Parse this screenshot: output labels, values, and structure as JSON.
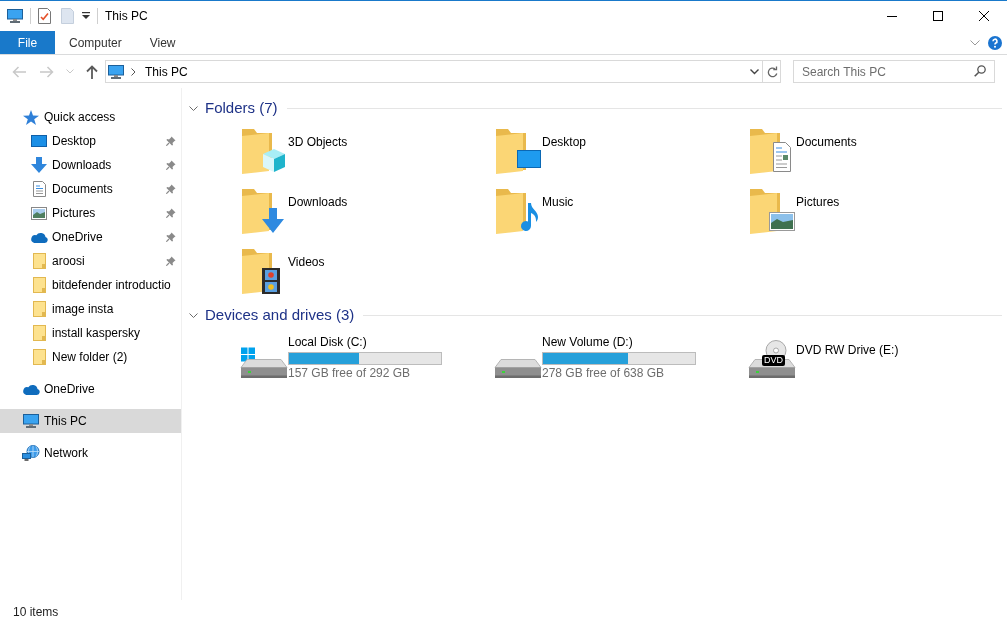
{
  "window": {
    "title": "This PC"
  },
  "ribbon": {
    "tabs": [
      {
        "label": "File",
        "kind": "file"
      },
      {
        "label": "Computer",
        "kind": "tab"
      },
      {
        "label": "View",
        "kind": "tab"
      }
    ]
  },
  "toolbar": {
    "nav_buttons": [
      {
        "kind": "back",
        "disabled": true
      },
      {
        "kind": "forward",
        "disabled": true
      },
      {
        "kind": "recent",
        "disabled": true
      },
      {
        "kind": "up",
        "disabled": false
      }
    ],
    "address": {
      "path": [
        "This PC"
      ]
    },
    "search": {
      "placeholder": "Search This PC"
    }
  },
  "navigation": {
    "items": [
      {
        "label": "Quick access",
        "kind": "quickaccess",
        "selected": false,
        "children": [
          {
            "label": "Desktop",
            "kind": "desktop",
            "pinned": true,
            "selected": false
          },
          {
            "label": "Downloads",
            "kind": "downloads",
            "pinned": true,
            "selected": false
          },
          {
            "label": "Documents",
            "kind": "documents",
            "pinned": true,
            "selected": false
          },
          {
            "label": "Pictures",
            "kind": "pictures",
            "pinned": true,
            "selected": false
          },
          {
            "label": "OneDrive",
            "kind": "onedrive",
            "pinned": true,
            "selected": false
          },
          {
            "label": "aroosi",
            "kind": "folder",
            "pinned": true,
            "selected": false
          },
          {
            "label": "bitdefender introductio",
            "kind": "folder",
            "pinned": false,
            "selected": false
          },
          {
            "label": "image insta",
            "kind": "folder",
            "pinned": false,
            "selected": false
          },
          {
            "label": "install kaspersky",
            "kind": "folder",
            "pinned": false,
            "selected": false
          },
          {
            "label": "New folder (2)",
            "kind": "folder",
            "pinned": false,
            "selected": false
          }
        ]
      },
      {
        "label": "OneDrive",
        "kind": "onedrive",
        "selected": false
      },
      {
        "label": "This PC",
        "kind": "pc",
        "selected": true
      },
      {
        "label": "Network",
        "kind": "network",
        "selected": false
      }
    ]
  },
  "content": {
    "groups": [
      {
        "title": "Folders (7)",
        "kind": "folders",
        "expanded": true,
        "items": [
          {
            "name": "3D Objects",
            "kind": "objects"
          },
          {
            "name": "Desktop",
            "kind": "desktop"
          },
          {
            "name": "Documents",
            "kind": "documents"
          },
          {
            "name": "Downloads",
            "kind": "downloads"
          },
          {
            "name": "Music",
            "kind": "music"
          },
          {
            "name": "Pictures",
            "kind": "pictures"
          },
          {
            "name": "Videos",
            "kind": "videos"
          }
        ]
      },
      {
        "title": "Devices and drives (3)",
        "kind": "drives",
        "expanded": true,
        "items": [
          {
            "name": "Local Disk (C:)",
            "kind": "system",
            "level": 0.46,
            "reading": "157 GB free of 292 GB"
          },
          {
            "name": "New Volume (D:)",
            "kind": "disk",
            "level": 0.56,
            "reading": "278 GB free of 638 GB"
          },
          {
            "name": "DVD RW Drive (E:)",
            "kind": "optical",
            "icon_label": "DVD"
          }
        ]
      }
    ]
  },
  "status_bar": {
    "text": "10 items"
  }
}
